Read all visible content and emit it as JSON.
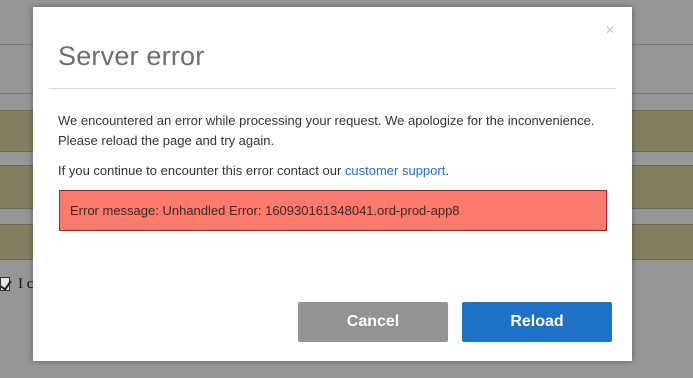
{
  "background": {
    "visible_text": "I c"
  },
  "modal": {
    "close_glyph": "×",
    "title": "Server error",
    "message_line1": "We encountered an error while processing your request. We apologize for the inconvenience.",
    "message_line2": "Please reload the page and try again.",
    "contact_prefix": "If you continue to encounter this error contact our ",
    "contact_link": "customer support",
    "contact_suffix": ".",
    "error_message": "Error message: Unhandled Error: 160930161348041.ord-prod-app8",
    "cancel_label": "Cancel",
    "reload_label": "Reload"
  },
  "colors": {
    "error_background": "#fa7a6e",
    "error_border": "#a02a24",
    "reload_button": "#1f70c7",
    "cancel_button": "#939393",
    "link": "#1f6fc8"
  }
}
